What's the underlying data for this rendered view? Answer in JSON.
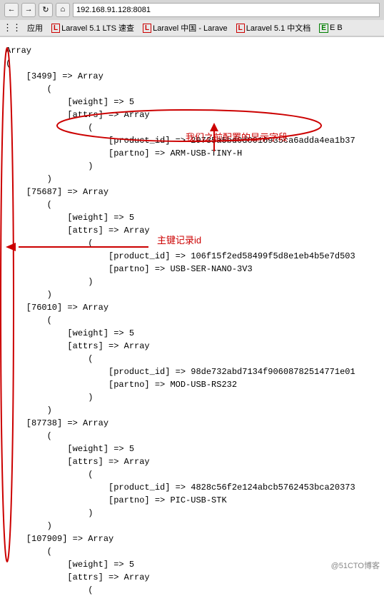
{
  "browser": {
    "address": "192.168.91.128:8081",
    "nav_back": "←",
    "nav_forward": "→",
    "nav_refresh": "↻",
    "nav_home": "⌂",
    "bookmarks": [
      {
        "label": "应用",
        "icon": "grid"
      },
      {
        "label": "Laravel 5.1 LTS 速查",
        "color": "red"
      },
      {
        "label": "Laravel 中国 - Larave",
        "color": "red"
      },
      {
        "label": "Laravel 5.1 中文档",
        "color": "red"
      },
      {
        "label": "E B",
        "color": "green"
      }
    ]
  },
  "content": {
    "lines": [
      "Array",
      "(",
      "    [3499] => Array",
      "        (",
      "            [weight] => 5",
      "            [attrs] => Array",
      "                (",
      "                    [product_id] => 29735a5bd0d0016935ca6adda4ea1b37",
      "                    [partno] => ARM-USB-TINY-H",
      "                )",
      "        )",
      "",
      "    [75687] => Array",
      "        (",
      "            [weight] => 5",
      "            [attrs] => Array",
      "                (",
      "                    [product_id] => 106f15f2ed58499f5d8e1eb4b5e7d503",
      "                    [partno] => USB-SER-NANO-3V3",
      "                )",
      "        )",
      "",
      "    [76010] => Array",
      "        (",
      "            [weight] => 5",
      "            [attrs] => Array",
      "                (",
      "                    [product_id] => 98de732abd7134f90608782514771e01",
      "                    [partno] => MOD-USB-RS232",
      "                )",
      "        )",
      "",
      "    [87738] => Array",
      "        (",
      "            [weight] => 5",
      "            [attrs] => Array",
      "                (",
      "                    [product_id] => 4828c56f2e124abcb5762453bca20373",
      "                    [partno] => PIC-USB-STK",
      "                )",
      "        )",
      "",
      "    [107909] => Array",
      "        (",
      "            [weight] => 5",
      "            [attrs] => Array",
      "                ("
    ]
  },
  "annotations": {
    "oval_label": "我们之前配置的显示字段",
    "arrow_label": "主键记录id"
  },
  "watermark": "@51CTO博客"
}
